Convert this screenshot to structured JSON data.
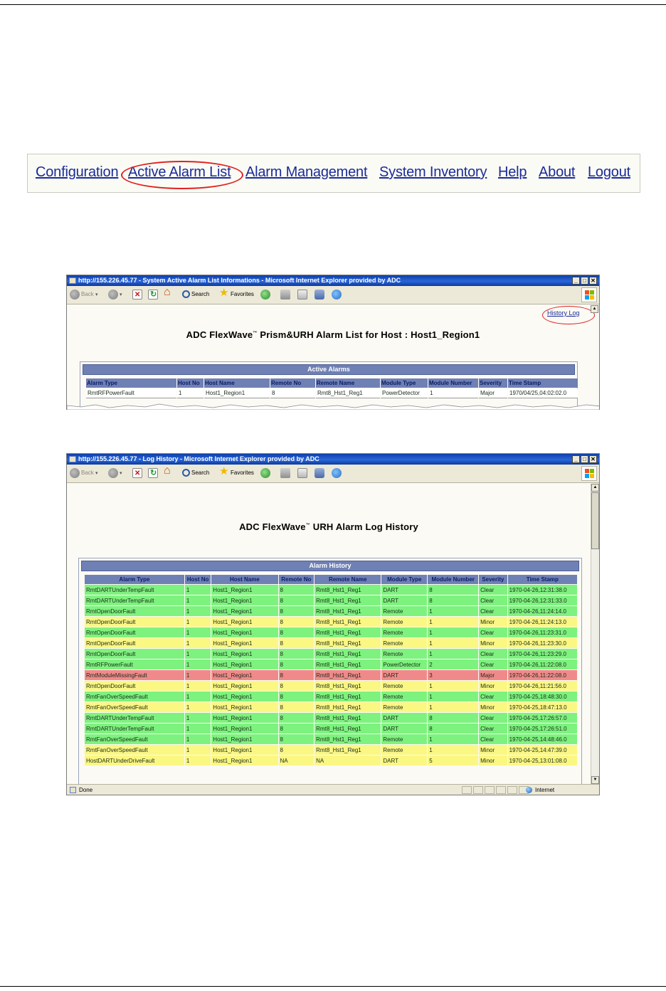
{
  "nav": {
    "items": [
      "Configuration",
      "Active Alarm List",
      "Alarm Management",
      "System Inventory",
      "Help",
      "About",
      "Logout"
    ]
  },
  "toolbar": {
    "back": "Back",
    "search": "Search",
    "favorites": "Favorites"
  },
  "window1": {
    "title": "http://155.226.45.77 - System Active Alarm List Informations - Microsoft Internet Explorer provided by ADC",
    "history_link": "History Log",
    "heading_pre": "ADC FlexWave",
    "heading_tm": "™",
    "heading_post": " Prism&URH Alarm List for Host : Host1_Region1",
    "panel_title": "Active Alarms",
    "columns": [
      "Alarm Type",
      "Host No",
      "Host Name",
      "Remote No",
      "Remote Name",
      "Module Type",
      "Module Number",
      "Severity",
      "Time Stamp"
    ],
    "rows": [
      [
        "RmtRFPowerFault",
        "1",
        "Host1_Region1",
        "8",
        "Rmt8_Hst1_Reg1",
        "PowerDetector",
        "1",
        "Major",
        "1970/04/25,04:02:02.0"
      ]
    ]
  },
  "window2": {
    "title": "http://155.226.45.77 - Log History - Microsoft Internet Explorer provided by ADC",
    "heading_pre": "ADC FlexWave",
    "heading_tm": "™",
    "heading_post": " URH Alarm Log History",
    "panel_title": "Alarm History",
    "columns": [
      "Alarm Type",
      "Host No",
      "Host Name",
      "Remote No",
      "Remote Name",
      "Module Type",
      "Module Number",
      "Severity",
      "Time Stamp"
    ],
    "rows": [
      [
        "RmtDARTUnderTempFault",
        "1",
        "Host1_Region1",
        "8",
        "Rmt8_Hst1_Reg1",
        "DART",
        "8",
        "Clear",
        "1970-04-26,12:31:38.0"
      ],
      [
        "RmtDARTUnderTempFault",
        "1",
        "Host1_Region1",
        "8",
        "Rmt8_Hst1_Reg1",
        "DART",
        "8",
        "Clear",
        "1970-04-26,12:31:33.0"
      ],
      [
        "RmtOpenDoorFault",
        "1",
        "Host1_Region1",
        "8",
        "Rmt8_Hst1_Reg1",
        "Remote",
        "1",
        "Clear",
        "1970-04-26,11:24:14.0"
      ],
      [
        "RmtOpenDoorFault",
        "1",
        "Host1_Region1",
        "8",
        "Rmt8_Hst1_Reg1",
        "Remote",
        "1",
        "Minor",
        "1970-04-26,11:24:13.0"
      ],
      [
        "RmtOpenDoorFault",
        "1",
        "Host1_Region1",
        "8",
        "Rmt8_Hst1_Reg1",
        "Remote",
        "1",
        "Clear",
        "1970-04-26,11:23:31.0"
      ],
      [
        "RmtOpenDoorFault",
        "1",
        "Host1_Region1",
        "8",
        "Rmt8_Hst1_Reg1",
        "Remote",
        "1",
        "Minor",
        "1970-04-26,11:23:30.0"
      ],
      [
        "RmtOpenDoorFault",
        "1",
        "Host1_Region1",
        "8",
        "Rmt8_Hst1_Reg1",
        "Remote",
        "1",
        "Clear",
        "1970-04-26,11:23:29.0"
      ],
      [
        "RmtRFPowerFault",
        "1",
        "Host1_Region1",
        "8",
        "Rmt8_Hst1_Reg1",
        "PowerDetector",
        "2",
        "Clear",
        "1970-04-26,11:22:08.0"
      ],
      [
        "RmtModuleMissingFault",
        "1",
        "Host1_Region1",
        "8",
        "Rmt8_Hst1_Reg1",
        "DART",
        "3",
        "Major",
        "1970-04-26,11:22:08.0"
      ],
      [
        "RmtOpenDoorFault",
        "1",
        "Host1_Region1",
        "8",
        "Rmt8_Hst1_Reg1",
        "Remote",
        "1",
        "Minor",
        "1970-04-26,11:21:56.0"
      ],
      [
        "RmtFanOverSpeedFault",
        "1",
        "Host1_Region1",
        "8",
        "Rmt8_Hst1_Reg1",
        "Remote",
        "1",
        "Clear",
        "1970-04-25,18:48:30.0"
      ],
      [
        "RmtFanOverSpeedFault",
        "1",
        "Host1_Region1",
        "8",
        "Rmt8_Hst1_Reg1",
        "Remote",
        "1",
        "Minor",
        "1970-04-25,18:47:13.0"
      ],
      [
        "RmtDARTUnderTempFault",
        "1",
        "Host1_Region1",
        "8",
        "Rmt8_Hst1_Reg1",
        "DART",
        "8",
        "Clear",
        "1970-04-25,17:26:57.0"
      ],
      [
        "RmtDARTUnderTempFault",
        "1",
        "Host1_Region1",
        "8",
        "Rmt8_Hst1_Reg1",
        "DART",
        "8",
        "Clear",
        "1970-04-25,17:26:51.0"
      ],
      [
        "RmtFanOverSpeedFault",
        "1",
        "Host1_Region1",
        "8",
        "Rmt8_Hst1_Reg1",
        "Remote",
        "1",
        "Clear",
        "1970-04-25,14:48:46.0"
      ],
      [
        "RmtFanOverSpeedFault",
        "1",
        "Host1_Region1",
        "8",
        "Rmt8_Hst1_Reg1",
        "Remote",
        "1",
        "Minor",
        "1970-04-25,14:47:39.0"
      ],
      [
        "HostDARTUnderDriveFault",
        "1",
        "Host1_Region1",
        "NA",
        "NA",
        "DART",
        "5",
        "Minor",
        "1970-04-25,13:01:08.0"
      ]
    ],
    "status_left": "Done",
    "status_zone": "Internet"
  },
  "colors": {
    "clear": "#7ef27e",
    "minor": "#fbf783",
    "major": "#f08a8a",
    "header": "#6f80b4",
    "link": "#1a2b9a",
    "highlight_oval": "#e02020"
  }
}
